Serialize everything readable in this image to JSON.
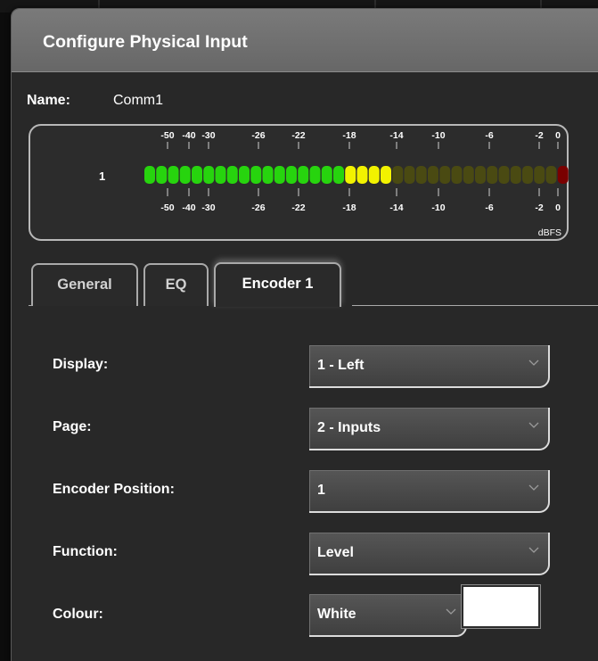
{
  "dialog": {
    "title": "Configure Physical Input"
  },
  "name": {
    "label": "Name:",
    "value": "Comm1"
  },
  "meter": {
    "channel_label": "1",
    "scale_ticks": [
      "-50",
      "-40",
      "-30",
      "-26",
      "-22",
      "-18",
      "-14",
      "-10",
      "-6",
      "-2",
      "0"
    ],
    "unit": "dBFS",
    "total_segments": 36,
    "lit_green_segments": 17,
    "lit_yellow_segments": 4,
    "peak_segments": 1,
    "colors": {
      "green": "#27d40e",
      "yellow": "#f2f200",
      "dim_olive": "#4a4a12",
      "peak_red": "#7a0000"
    }
  },
  "tabs": [
    {
      "label": "General",
      "active": false
    },
    {
      "label": "EQ",
      "active": false
    },
    {
      "label": "Encoder 1",
      "active": true
    }
  ],
  "fields": {
    "display": {
      "label": "Display:",
      "value": "1 - Left"
    },
    "page": {
      "label": "Page:",
      "value": "2 - Inputs"
    },
    "encoder_position": {
      "label": "Encoder Position:",
      "value": "1"
    },
    "function": {
      "label": "Function:",
      "value": "Level"
    },
    "colour": {
      "label": "Colour:",
      "value": "White",
      "swatch_color": "#ffffff"
    }
  },
  "icons": {
    "dropdown_chevron": "chevron-down-icon"
  }
}
